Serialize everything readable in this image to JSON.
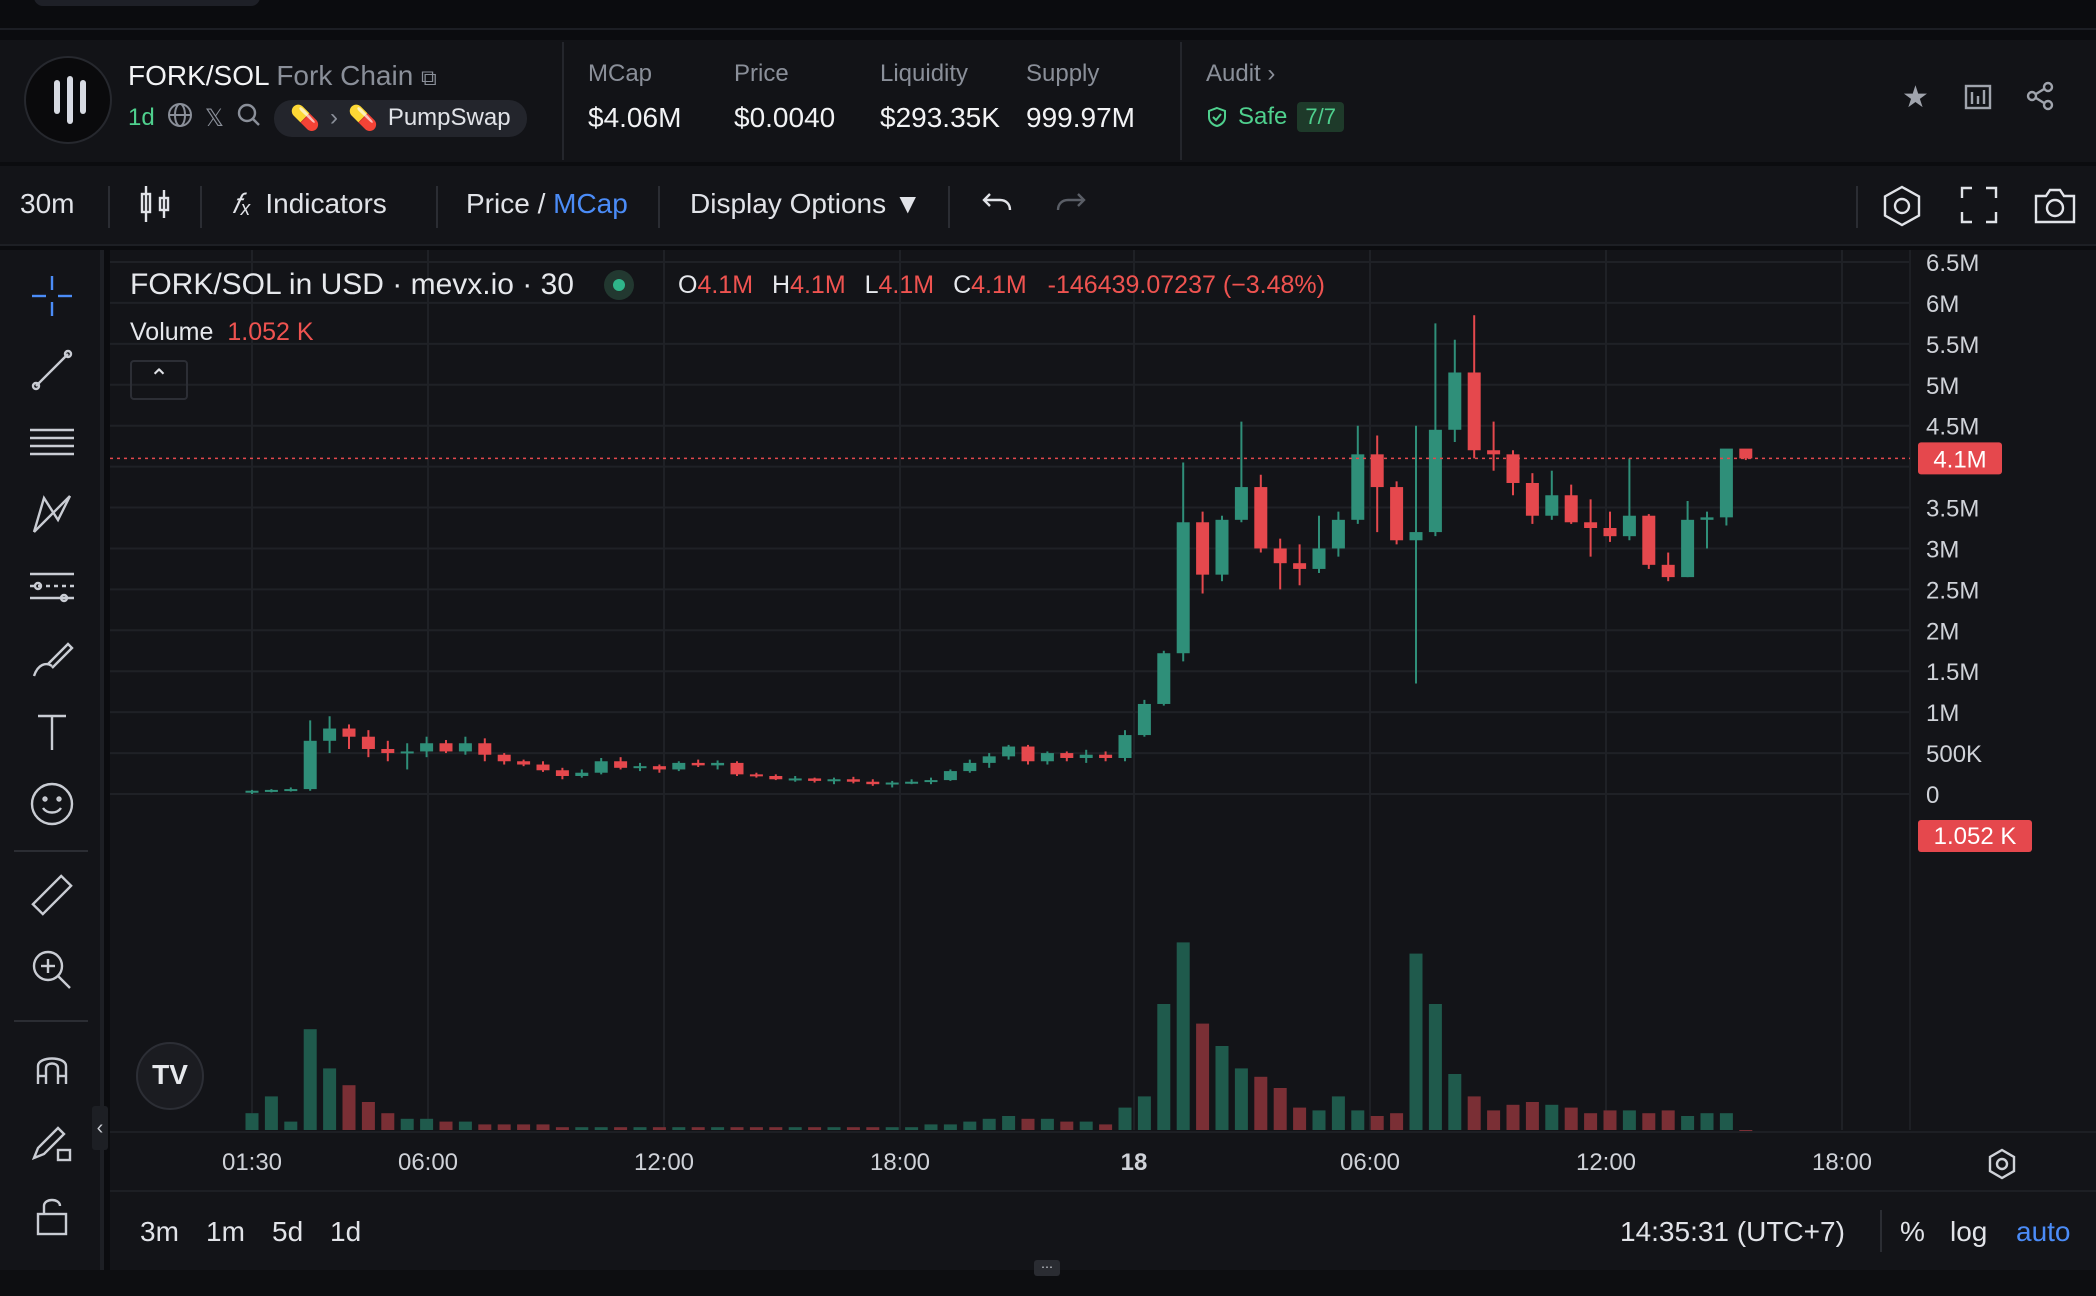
{
  "header": {
    "pair": "FORK/SOL",
    "chain": "Fork Chain",
    "age": "1d",
    "dex": "PumpSwap",
    "stats": [
      {
        "label": "MCap",
        "value": "$4.06M"
      },
      {
        "label": "Price",
        "value": "$0.0040"
      },
      {
        "label": "Liquidity",
        "value": "$293.35K"
      },
      {
        "label": "Supply",
        "value": "999.97M"
      }
    ],
    "audit": {
      "label": "Audit",
      "status": "Safe",
      "score": "7/7"
    }
  },
  "toolbar": {
    "interval": "30m",
    "indicators": "Indicators",
    "price_label": "Price",
    "slash": "/",
    "mcap_label": "MCap",
    "display_options": "Display Options ▼"
  },
  "chart_legend": {
    "title": "FORK/SOL in USD · mevx.io · 30",
    "o_label": "O",
    "o_value": "4.1M",
    "h_label": "H",
    "h_value": "4.1M",
    "l_label": "L",
    "l_value": "4.1M",
    "c_label": "C",
    "c_value": "4.1M",
    "change": "-146439.07237 (−3.48%)",
    "volume_label": "Volume",
    "volume_value": "1.052 K"
  },
  "price_badge": "4.1M",
  "volume_badge": "1.052 K",
  "bottom": {
    "ranges": [
      "3m",
      "1m",
      "5d",
      "1d"
    ],
    "clock": "14:35:31 (UTC+7)",
    "percent": "%",
    "log": "log",
    "auto": "auto"
  },
  "colors": {
    "up": "#2f8f79",
    "down": "#e5484d",
    "accent": "#4b8cf7",
    "positive": "#4fd08e"
  },
  "chart_data": {
    "type": "candlestick",
    "y_axis_ticks": [
      "6.5M",
      "6M",
      "5.5M",
      "5M",
      "4.5M",
      "4.1M",
      "3.5M",
      "3M",
      "2.5M",
      "2M",
      "1.5M",
      "1M",
      "500K",
      "0"
    ],
    "x_axis_ticks": [
      "01:30",
      "06:00",
      "12:00",
      "18:00",
      "18",
      "06:00",
      "12:00",
      "18:00"
    ],
    "last_price": 4.1,
    "unit": "M",
    "candles": [
      {
        "o": 0.02,
        "h": 0.05,
        "l": 0.0,
        "c": 0.04
      },
      {
        "o": 0.04,
        "h": 0.06,
        "l": 0.02,
        "c": 0.05
      },
      {
        "o": 0.05,
        "h": 0.08,
        "l": 0.03,
        "c": 0.06
      },
      {
        "o": 0.06,
        "h": 0.9,
        "l": 0.04,
        "c": 0.65
      },
      {
        "o": 0.65,
        "h": 0.95,
        "l": 0.5,
        "c": 0.8
      },
      {
        "o": 0.8,
        "h": 0.85,
        "l": 0.55,
        "c": 0.7
      },
      {
        "o": 0.7,
        "h": 0.78,
        "l": 0.45,
        "c": 0.55
      },
      {
        "o": 0.55,
        "h": 0.65,
        "l": 0.4,
        "c": 0.5
      },
      {
        "o": 0.5,
        "h": 0.62,
        "l": 0.3,
        "c": 0.52
      },
      {
        "o": 0.52,
        "h": 0.7,
        "l": 0.45,
        "c": 0.62
      },
      {
        "o": 0.62,
        "h": 0.66,
        "l": 0.5,
        "c": 0.52
      },
      {
        "o": 0.52,
        "h": 0.7,
        "l": 0.48,
        "c": 0.62
      },
      {
        "o": 0.62,
        "h": 0.68,
        "l": 0.4,
        "c": 0.48
      },
      {
        "o": 0.48,
        "h": 0.5,
        "l": 0.36,
        "c": 0.4
      },
      {
        "o": 0.4,
        "h": 0.42,
        "l": 0.34,
        "c": 0.36
      },
      {
        "o": 0.36,
        "h": 0.4,
        "l": 0.27,
        "c": 0.29
      },
      {
        "o": 0.29,
        "h": 0.32,
        "l": 0.18,
        "c": 0.22
      },
      {
        "o": 0.22,
        "h": 0.3,
        "l": 0.2,
        "c": 0.26
      },
      {
        "o": 0.26,
        "h": 0.44,
        "l": 0.24,
        "c": 0.4
      },
      {
        "o": 0.4,
        "h": 0.45,
        "l": 0.3,
        "c": 0.32
      },
      {
        "o": 0.32,
        "h": 0.38,
        "l": 0.28,
        "c": 0.34
      },
      {
        "o": 0.34,
        "h": 0.36,
        "l": 0.26,
        "c": 0.3
      },
      {
        "o": 0.3,
        "h": 0.4,
        "l": 0.28,
        "c": 0.38
      },
      {
        "o": 0.38,
        "h": 0.42,
        "l": 0.33,
        "c": 0.35
      },
      {
        "o": 0.35,
        "h": 0.41,
        "l": 0.3,
        "c": 0.38
      },
      {
        "o": 0.38,
        "h": 0.4,
        "l": 0.22,
        "c": 0.24
      },
      {
        "o": 0.24,
        "h": 0.26,
        "l": 0.2,
        "c": 0.22
      },
      {
        "o": 0.22,
        "h": 0.24,
        "l": 0.17,
        "c": 0.18
      },
      {
        "o": 0.18,
        "h": 0.22,
        "l": 0.15,
        "c": 0.19
      },
      {
        "o": 0.19,
        "h": 0.2,
        "l": 0.14,
        "c": 0.16
      },
      {
        "o": 0.16,
        "h": 0.2,
        "l": 0.12,
        "c": 0.18
      },
      {
        "o": 0.18,
        "h": 0.21,
        "l": 0.13,
        "c": 0.15
      },
      {
        "o": 0.15,
        "h": 0.18,
        "l": 0.1,
        "c": 0.12
      },
      {
        "o": 0.12,
        "h": 0.16,
        "l": 0.08,
        "c": 0.14
      },
      {
        "o": 0.14,
        "h": 0.18,
        "l": 0.12,
        "c": 0.15
      },
      {
        "o": 0.15,
        "h": 0.2,
        "l": 0.12,
        "c": 0.17
      },
      {
        "o": 0.17,
        "h": 0.3,
        "l": 0.16,
        "c": 0.28
      },
      {
        "o": 0.28,
        "h": 0.42,
        "l": 0.26,
        "c": 0.38
      },
      {
        "o": 0.38,
        "h": 0.5,
        "l": 0.32,
        "c": 0.46
      },
      {
        "o": 0.46,
        "h": 0.6,
        "l": 0.42,
        "c": 0.58
      },
      {
        "o": 0.58,
        "h": 0.6,
        "l": 0.36,
        "c": 0.4
      },
      {
        "o": 0.4,
        "h": 0.52,
        "l": 0.36,
        "c": 0.5
      },
      {
        "o": 0.5,
        "h": 0.52,
        "l": 0.4,
        "c": 0.44
      },
      {
        "o": 0.44,
        "h": 0.54,
        "l": 0.38,
        "c": 0.48
      },
      {
        "o": 0.48,
        "h": 0.52,
        "l": 0.4,
        "c": 0.44
      },
      {
        "o": 0.44,
        "h": 0.78,
        "l": 0.4,
        "c": 0.72
      },
      {
        "o": 0.72,
        "h": 1.15,
        "l": 0.7,
        "c": 1.1
      },
      {
        "o": 1.1,
        "h": 1.75,
        "l": 1.08,
        "c": 1.72
      },
      {
        "o": 1.72,
        "h": 4.05,
        "l": 1.62,
        "c": 3.32
      },
      {
        "o": 3.32,
        "h": 3.45,
        "l": 2.45,
        "c": 2.68
      },
      {
        "o": 2.68,
        "h": 3.4,
        "l": 2.6,
        "c": 3.35
      },
      {
        "o": 3.35,
        "h": 4.55,
        "l": 3.32,
        "c": 3.75
      },
      {
        "o": 3.75,
        "h": 3.9,
        "l": 2.95,
        "c": 3.0
      },
      {
        "o": 3.0,
        "h": 3.12,
        "l": 2.5,
        "c": 2.82
      },
      {
        "o": 2.82,
        "h": 3.05,
        "l": 2.55,
        "c": 2.75
      },
      {
        "o": 2.75,
        "h": 3.4,
        "l": 2.7,
        "c": 3.0
      },
      {
        "o": 3.0,
        "h": 3.45,
        "l": 2.9,
        "c": 3.35
      },
      {
        "o": 3.35,
        "h": 4.5,
        "l": 3.3,
        "c": 4.15
      },
      {
        "o": 4.15,
        "h": 4.38,
        "l": 3.2,
        "c": 3.75
      },
      {
        "o": 3.75,
        "h": 3.82,
        "l": 3.05,
        "c": 3.1
      },
      {
        "o": 3.1,
        "h": 4.5,
        "l": 1.35,
        "c": 3.2
      },
      {
        "o": 3.2,
        "h": 5.75,
        "l": 3.15,
        "c": 4.45
      },
      {
        "o": 4.45,
        "h": 5.55,
        "l": 4.3,
        "c": 5.15
      },
      {
        "o": 5.15,
        "h": 5.85,
        "l": 4.1,
        "c": 4.2
      },
      {
        "o": 4.2,
        "h": 4.55,
        "l": 3.95,
        "c": 4.15
      },
      {
        "o": 4.15,
        "h": 4.2,
        "l": 3.65,
        "c": 3.8
      },
      {
        "o": 3.8,
        "h": 3.92,
        "l": 3.3,
        "c": 3.4
      },
      {
        "o": 3.4,
        "h": 3.95,
        "l": 3.35,
        "c": 3.65
      },
      {
        "o": 3.65,
        "h": 3.78,
        "l": 3.3,
        "c": 3.32
      },
      {
        "o": 3.32,
        "h": 3.6,
        "l": 2.9,
        "c": 3.25
      },
      {
        "o": 3.25,
        "h": 3.45,
        "l": 3.08,
        "c": 3.15
      },
      {
        "o": 3.15,
        "h": 4.1,
        "l": 3.1,
        "c": 3.4
      },
      {
        "o": 3.4,
        "h": 3.42,
        "l": 2.75,
        "c": 2.8
      },
      {
        "o": 2.8,
        "h": 2.95,
        "l": 2.6,
        "c": 2.65
      },
      {
        "o": 2.65,
        "h": 3.58,
        "l": 2.65,
        "c": 3.35
      },
      {
        "o": 3.35,
        "h": 3.45,
        "l": 3.0,
        "c": 3.38
      },
      {
        "o": 3.38,
        "h": 4.2,
        "l": 3.28,
        "c": 4.22
      },
      {
        "o": 4.22,
        "h": 4.2,
        "l": 4.08,
        "c": 4.1
      }
    ],
    "volumes": [
      0.06,
      0.12,
      0.03,
      0.36,
      0.22,
      0.16,
      0.1,
      0.06,
      0.04,
      0.04,
      0.03,
      0.03,
      0.02,
      0.02,
      0.02,
      0.02,
      0.01,
      0.01,
      0.01,
      0.01,
      0.01,
      0.01,
      0.01,
      0.01,
      0.01,
      0.01,
      0.01,
      0.01,
      0.01,
      0.01,
      0.01,
      0.01,
      0.01,
      0.01,
      0.01,
      0.02,
      0.02,
      0.03,
      0.04,
      0.05,
      0.04,
      0.04,
      0.03,
      0.03,
      0.02,
      0.08,
      0.12,
      0.45,
      0.67,
      0.38,
      0.3,
      0.22,
      0.19,
      0.15,
      0.08,
      0.07,
      0.12,
      0.07,
      0.05,
      0.06,
      0.63,
      0.45,
      0.2,
      0.12,
      0.07,
      0.09,
      0.1,
      0.09,
      0.08,
      0.06,
      0.07,
      0.07,
      0.06,
      0.07,
      0.05,
      0.06,
      0.06,
      0.0
    ]
  }
}
